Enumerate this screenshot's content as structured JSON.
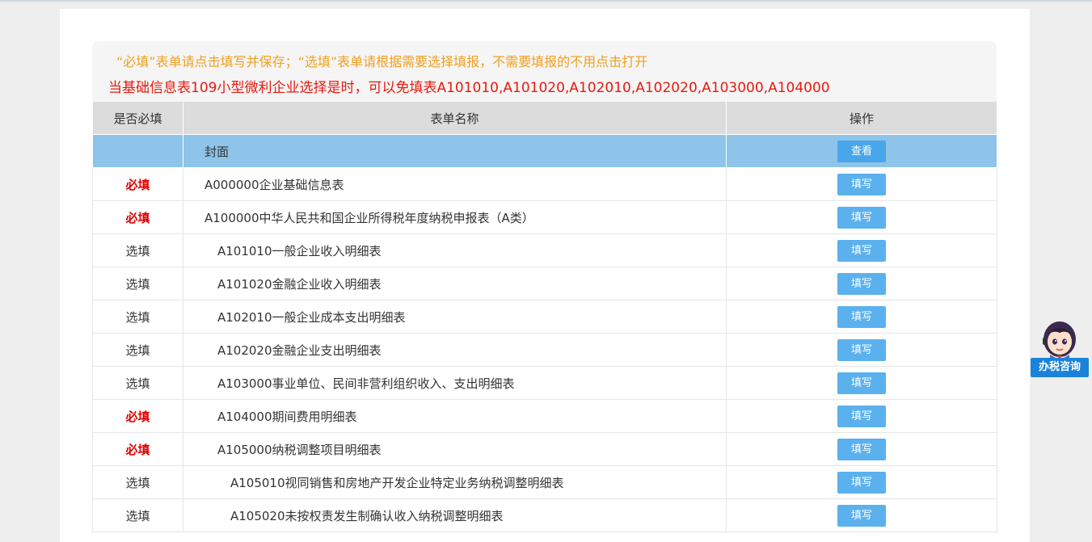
{
  "notice": {
    "line1": "“必填”表单请点击填写并保存；“选填”表单请根据需要选择填报，不需要填报的不用点击打开",
    "line2": "当基础信息表109小型微利企业选择是时，可以免填表A101010,A101020,A102010,A102020,A103000,A104000"
  },
  "table": {
    "headers": [
      "是否必填",
      "表单名称",
      "操作"
    ],
    "rows": [
      {
        "req": "",
        "name": "封面",
        "action": "查看",
        "indent": 0,
        "required": false,
        "cover": true
      },
      {
        "req": "必填",
        "name": "A000000企业基础信息表",
        "action": "填写",
        "indent": 0,
        "required": true
      },
      {
        "req": "必填",
        "name": "A100000中华人民共和国企业所得税年度纳税申报表（A类）",
        "action": "填写",
        "indent": 0,
        "required": true
      },
      {
        "req": "选填",
        "name": "A101010一般企业收入明细表",
        "action": "填写",
        "indent": 1,
        "required": false
      },
      {
        "req": "选填",
        "name": "A101020金融企业收入明细表",
        "action": "填写",
        "indent": 1,
        "required": false
      },
      {
        "req": "选填",
        "name": "A102010一般企业成本支出明细表",
        "action": "填写",
        "indent": 1,
        "required": false
      },
      {
        "req": "选填",
        "name": "A102020金融企业支出明细表",
        "action": "填写",
        "indent": 1,
        "required": false
      },
      {
        "req": "选填",
        "name": "A103000事业单位、民间非营利组织收入、支出明细表",
        "action": "填写",
        "indent": 1,
        "required": false
      },
      {
        "req": "必填",
        "name": "A104000期间费用明细表",
        "action": "填写",
        "indent": 1,
        "required": true
      },
      {
        "req": "必填",
        "name": "A105000纳税调整项目明细表",
        "action": "填写",
        "indent": 1,
        "required": true
      },
      {
        "req": "选填",
        "name": "A105010视同销售和房地产开发企业特定业务纳税调整明细表",
        "action": "填写",
        "indent": 2,
        "required": false
      },
      {
        "req": "选填",
        "name": "A105020未按权责发生制确认收入纳税调整明细表",
        "action": "填写",
        "indent": 2,
        "required": false
      }
    ]
  },
  "advisor": {
    "label": "办税咨询",
    "icon": "customer-service-avatar-icon"
  },
  "colors": {
    "notice_orange": "#f0a020",
    "notice_red": "#e8190f",
    "cover_row": "#8ec4e9",
    "button": "#5bb1ee",
    "required": "#e00000"
  }
}
